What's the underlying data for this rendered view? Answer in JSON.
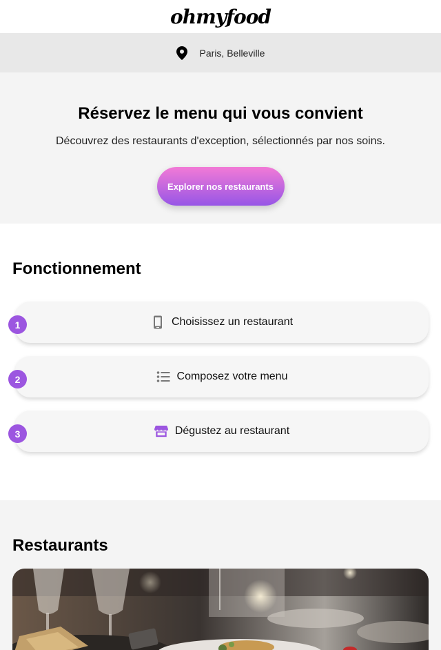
{
  "header": {
    "logo": "ohmyfood"
  },
  "location": {
    "text": "Paris, Belleville",
    "icon": "map-pin-icon"
  },
  "hero": {
    "title": "Réservez le menu qui vous convient",
    "subtitle": "Découvrez des restaurants d'exception, sélectionnés par nos soins.",
    "cta_label": "Explorer nos restaurants",
    "cta_gradient": [
      "#f27ad6",
      "#9756e6"
    ]
  },
  "how_it_works": {
    "title": "Fonctionnement",
    "badge_color": "#9c56e0",
    "steps": [
      {
        "number": "1",
        "label": "Choisissez un restaurant",
        "icon": "mobile-phone-icon"
      },
      {
        "number": "2",
        "label": "Composez votre menu",
        "icon": "list-icon"
      },
      {
        "number": "3",
        "label": "Dégustez au restaurant",
        "icon": "store-icon"
      }
    ]
  },
  "restaurants": {
    "title": "Restaurants"
  }
}
